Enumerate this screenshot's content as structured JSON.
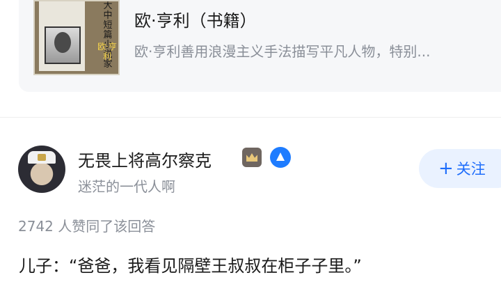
{
  "book_card": {
    "cover_text_vertical": "大中短篇小说家",
    "cover_author_vertical": "欧·亨利",
    "title": "欧·亨利（书籍）",
    "description": "欧·亨利善用浪漫主义手法描写平凡人物，特别..."
  },
  "answer": {
    "author": {
      "name": "无畏上将高尔察克",
      "subtitle": "迷茫的一代人啊",
      "badges": [
        "crown-icon",
        "verified-icon"
      ]
    },
    "follow_button": {
      "plus": "+",
      "label": "关注"
    },
    "likes_text": "2742 人赞同了该回答",
    "content_line": "儿子：“爸爸，我看见隔壁王叔叔在柜子子里。”"
  },
  "colors": {
    "accent": "#1e6dfb",
    "follow_bg": "#eaf2ff",
    "muted_text": "#8a8f98",
    "card_bg": "#f6f7f9"
  }
}
